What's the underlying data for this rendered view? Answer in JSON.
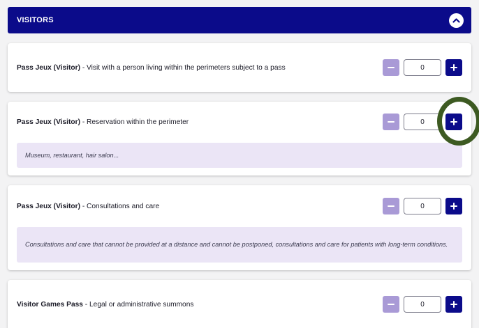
{
  "section": {
    "title": "VISITORS",
    "accent_color": "#0b0b8a",
    "minus_color": "#a99ad6",
    "note_bg": "#ebe5f6",
    "collapse_icon": "chevron-up-icon"
  },
  "items": [
    {
      "label_prefix": "Pass Jeux (Visitor)",
      "label_rest": " - Visit with a person living within the perimeters subject to a pass",
      "quantity": "0",
      "note": ""
    },
    {
      "label_prefix": "Pass Jeux (Visitor)",
      "label_rest": " - Reservation within the perimeter",
      "quantity": "0",
      "note": "Museum, restaurant, hair salon..."
    },
    {
      "label_prefix": "Pass Jeux (Visitor)",
      "label_rest": " - Consultations and care",
      "quantity": "0",
      "note": "Consultations and care that cannot be provided at a distance and cannot be postponed, consultations and care for patients with long-term conditions."
    },
    {
      "label_prefix": "Visitor Games Pass",
      "label_rest": " - Legal or administrative summons",
      "quantity": "0",
      "note": ""
    }
  ],
  "annotation": {
    "ring_color": "#3d5a22",
    "target": "increment-button"
  }
}
